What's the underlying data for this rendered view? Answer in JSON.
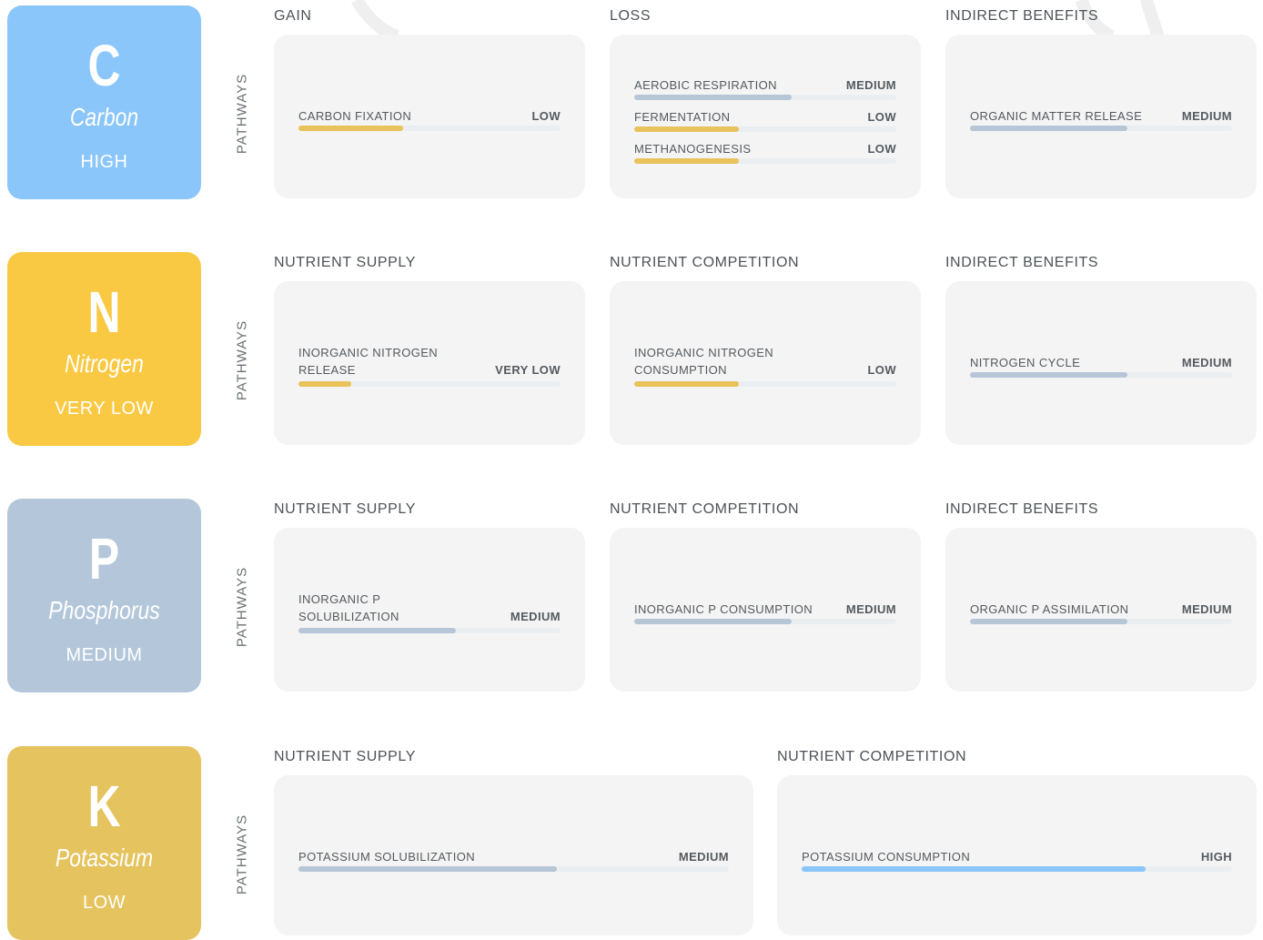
{
  "pathways_label": "PATHWAYS",
  "colors": {
    "tile_blue": "#8AC6F9",
    "tile_yellow": "#FAC943",
    "tile_slate": "#B4C7DA",
    "tile_gold": "#E5C35E",
    "bar_yellow": "#E8C25A",
    "bar_slate": "#B6C6D7",
    "bar_blue": "#8AC6F9",
    "track": "#EBEEF1",
    "card": "#F4F4F4"
  },
  "rows": [
    {
      "symbol": "C",
      "name": "Carbon",
      "level": "HIGH",
      "groups": [
        {
          "title": "GAIN",
          "items": [
            {
              "label": "CARBON FIXATION",
              "level": "LOW",
              "fraction": 0.4
            }
          ]
        },
        {
          "title": "LOSS",
          "items": [
            {
              "label": "AEROBIC RESPIRATION",
              "level": "MEDIUM",
              "fraction": 0.6
            },
            {
              "label": "FERMENTATION",
              "level": "LOW",
              "fraction": 0.4
            },
            {
              "label": "METHANOGENESIS",
              "level": "LOW",
              "fraction": 0.4
            }
          ]
        },
        {
          "title": "INDIRECT BENEFITS",
          "items": [
            {
              "label": "ORGANIC MATTER RELEASE",
              "level": "MEDIUM",
              "fraction": 0.6
            }
          ]
        }
      ]
    },
    {
      "symbol": "N",
      "name": "Nitrogen",
      "level": "VERY LOW",
      "groups": [
        {
          "title": "NUTRIENT SUPPLY",
          "items": [
            {
              "label": "INORGANIC NITROGEN RELEASE",
              "level": "VERY LOW",
              "fraction": 0.2
            }
          ]
        },
        {
          "title": "NUTRIENT COMPETITION",
          "items": [
            {
              "label": "INORGANIC NITROGEN CONSUMPTION",
              "level": "LOW",
              "fraction": 0.4
            }
          ]
        },
        {
          "title": "INDIRECT BENEFITS",
          "items": [
            {
              "label": "NITROGEN CYCLE",
              "level": "MEDIUM",
              "fraction": 0.6
            }
          ]
        }
      ]
    },
    {
      "symbol": "P",
      "name": "Phosphorus",
      "level": "MEDIUM",
      "groups": [
        {
          "title": "NUTRIENT SUPPLY",
          "items": [
            {
              "label": "INORGANIC P SOLUBILIZATION",
              "level": "MEDIUM",
              "fraction": 0.6
            }
          ]
        },
        {
          "title": "NUTRIENT COMPETITION",
          "items": [
            {
              "label": "INORGANIC P CONSUMPTION",
              "level": "MEDIUM",
              "fraction": 0.6
            }
          ]
        },
        {
          "title": "INDIRECT BENEFITS",
          "items": [
            {
              "label": "ORGANIC P ASSIMILATION",
              "level": "MEDIUM",
              "fraction": 0.6
            }
          ]
        }
      ]
    },
    {
      "symbol": "K",
      "name": "Potassium",
      "level": "LOW",
      "groups": [
        {
          "title": "NUTRIENT SUPPLY",
          "items": [
            {
              "label": "POTASSIUM SOLUBILIZATION",
              "level": "MEDIUM",
              "fraction": 0.6
            }
          ]
        },
        {
          "title": "NUTRIENT COMPETITION",
          "items": [
            {
              "label": "POTASSIUM CONSUMPTION",
              "level": "HIGH",
              "fraction": 0.8
            }
          ]
        }
      ]
    }
  ]
}
